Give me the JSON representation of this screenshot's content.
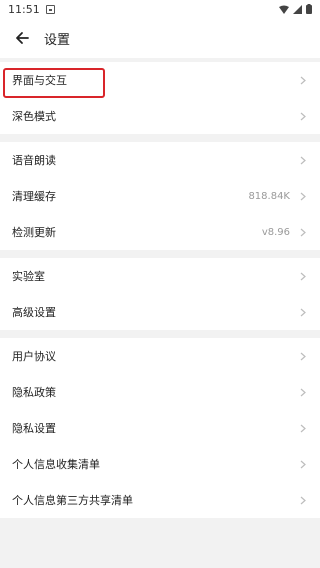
{
  "status_bar": {
    "time": "11:51"
  },
  "header": {
    "title": "设置"
  },
  "groups": [
    {
      "items": [
        {
          "label": "界面与交互",
          "value": ""
        },
        {
          "label": "深色模式",
          "value": ""
        }
      ]
    },
    {
      "items": [
        {
          "label": "语音朗读",
          "value": ""
        },
        {
          "label": "清理缓存",
          "value": "818.84K"
        },
        {
          "label": "检测更新",
          "value": "v8.96"
        }
      ]
    },
    {
      "items": [
        {
          "label": "实验室",
          "value": ""
        },
        {
          "label": "高级设置",
          "value": ""
        }
      ]
    },
    {
      "items": [
        {
          "label": "用户协议",
          "value": ""
        },
        {
          "label": "隐私政策",
          "value": ""
        },
        {
          "label": "隐私设置",
          "value": ""
        },
        {
          "label": "个人信息收集清单",
          "value": ""
        },
        {
          "label": "个人信息第三方共享清单",
          "value": ""
        }
      ]
    }
  ],
  "colors": {
    "highlight": "#d9252a",
    "background": "#f2f2f2"
  }
}
